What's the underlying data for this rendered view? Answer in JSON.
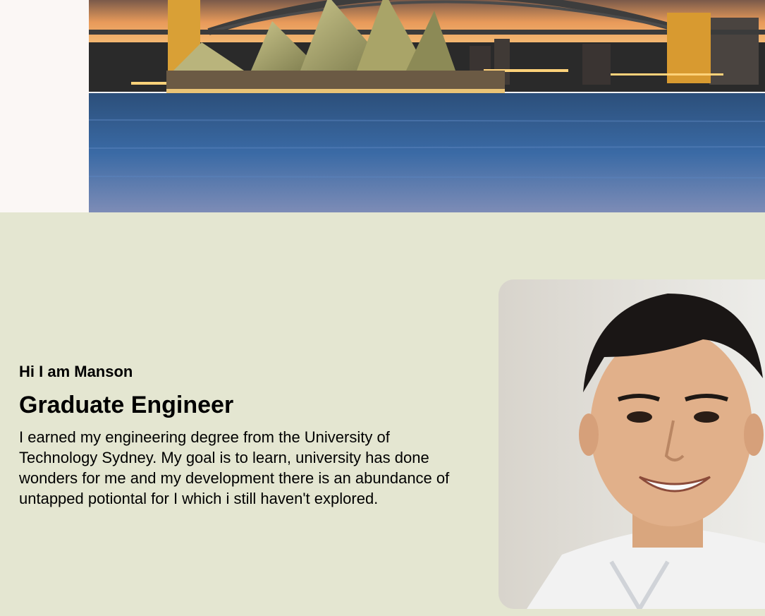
{
  "hero": {
    "image": "sydney-harbour-opera-house-sunset-photo"
  },
  "intro": {
    "greeting": "Hi I am Manson",
    "role": "Graduate Engineer",
    "bio": "I earned my engineering degree from the University of Technology Sydney. My goal is to learn, university has done wonders for me and my development there is an abundance of untapped potiontal for I which i still haven't explored."
  },
  "portrait": {
    "image": "profile-photo-smiling-man"
  },
  "colors": {
    "page_background": "#e4e6d1",
    "top_band": "#fbf7f5",
    "text": "#000000"
  }
}
